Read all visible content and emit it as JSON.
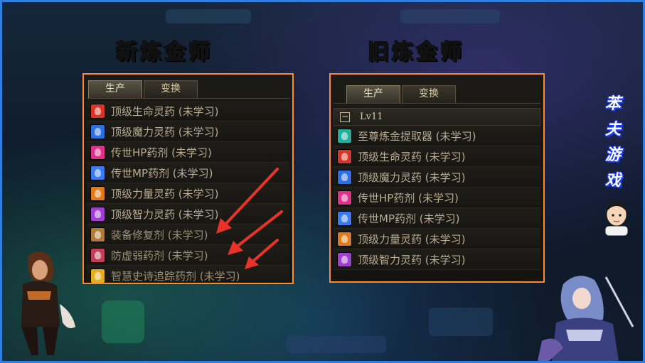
{
  "titles": {
    "new": "新炼金师",
    "old": "旧炼金师"
  },
  "new_panel": {
    "tabs": [
      {
        "label": "生产",
        "active": true
      },
      {
        "label": "变换",
        "active": false
      }
    ],
    "items": [
      {
        "label": "顶级生命灵药 (未学习)",
        "icon": "red-potion-icon",
        "color": "#d8352a"
      },
      {
        "label": "顶级魔力灵药 (未学习)",
        "icon": "blue-potion-icon",
        "color": "#2f6fe0"
      },
      {
        "label": "传世HP药剂 (未学习)",
        "icon": "pink-potion-icon",
        "color": "#e0308a"
      },
      {
        "label": "传世MP药剂 (未学习)",
        "icon": "blue-flask-icon",
        "color": "#3a7cf0"
      },
      {
        "label": "顶级力量灵药 (未学习)",
        "icon": "orange-potion-icon",
        "color": "#e07a1a"
      },
      {
        "label": "顶级智力灵药 (未学习)",
        "icon": "purple-potion-icon",
        "color": "#a040d0"
      },
      {
        "label": "装备修复剂 (未学习)",
        "icon": "repair-kit-icon",
        "color": "#b07a3a"
      },
      {
        "label": "防虚弱药剂 (未学习)",
        "icon": "pink-vial-icon",
        "color": "#c0405a"
      },
      {
        "label": "智慧史诗追踪药剂 (未学习)",
        "icon": "gold-flask-icon",
        "color": "#e0b020"
      }
    ]
  },
  "old_panel": {
    "tabs": [
      {
        "label": "生产",
        "active": true
      },
      {
        "label": "变换",
        "active": false
      }
    ],
    "group": {
      "collapse_symbol": "−",
      "label": "Lv11"
    },
    "items": [
      {
        "label": "至尊炼金提取器 (未学习)",
        "icon": "teal-crystal-icon",
        "color": "#20b0a0"
      },
      {
        "label": "顶级生命灵药 (未学习)",
        "icon": "red-potion-icon",
        "color": "#d8352a"
      },
      {
        "label": "顶级魔力灵药 (未学习)",
        "icon": "blue-potion-icon",
        "color": "#2f6fe0"
      },
      {
        "label": "传世HP药剂 (未学习)",
        "icon": "pink-potion-icon",
        "color": "#e0308a"
      },
      {
        "label": "传世MP药剂 (未学习)",
        "icon": "blue-flask-icon",
        "color": "#3a7cf0"
      },
      {
        "label": "顶级力量灵药 (未学习)",
        "icon": "orange-potion-icon",
        "color": "#e07a1a"
      },
      {
        "label": "顶级智力灵药 (未学习)",
        "icon": "purple-potion-icon",
        "color": "#a040d0"
      }
    ]
  },
  "brand": {
    "chars": [
      "苯",
      "夫",
      "游",
      "戏"
    ]
  },
  "colors": {
    "frame_border": "#2f7fe0",
    "panel_border": "#ff8a2a",
    "arrow": "#e8332a",
    "title_new": "#ffe14a",
    "title_old": "#4ee8ff"
  }
}
